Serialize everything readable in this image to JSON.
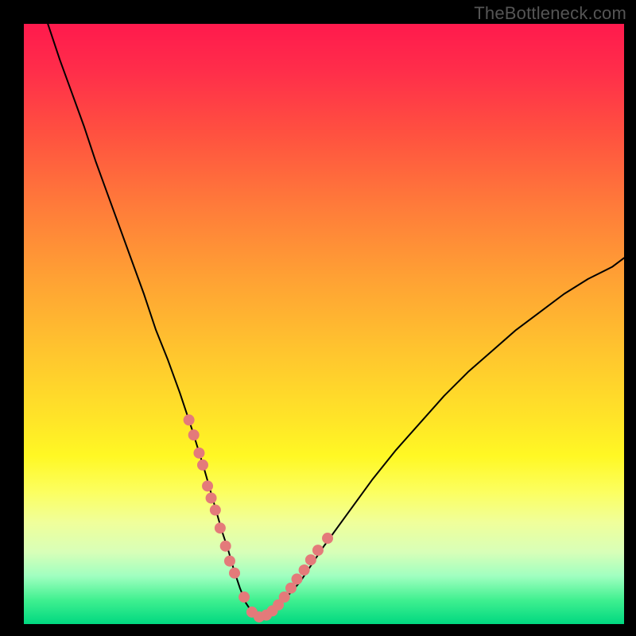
{
  "watermark": "TheBottleneck.com",
  "colors": {
    "frame": "#000000",
    "curve_stroke": "#000000",
    "dot_fill": "#e47a7a",
    "gradient_top": "#ff1a4d",
    "gradient_bottom": "#00d880"
  },
  "chart_data": {
    "type": "line",
    "title": "",
    "xlabel": "",
    "ylabel": "",
    "xlim": [
      0,
      100
    ],
    "ylim": [
      0,
      100
    ],
    "series": [
      {
        "name": "curve",
        "x": [
          4,
          6,
          8,
          10,
          12,
          14,
          16,
          18,
          20,
          22,
          24,
          26,
          28,
          30,
          31,
          32,
          33,
          34,
          35,
          36,
          37,
          38,
          39,
          40,
          42,
          46,
          50,
          54,
          58,
          62,
          66,
          70,
          74,
          78,
          82,
          86,
          90,
          94,
          98,
          100
        ],
        "y": [
          100,
          94,
          88.5,
          83,
          77,
          71.5,
          66,
          60.5,
          55,
          49,
          44,
          38.5,
          32.5,
          26,
          22.5,
          19,
          15.5,
          12.5,
          9,
          6,
          3.5,
          2,
          1.2,
          1.2,
          2.5,
          7,
          13,
          18.5,
          24,
          29,
          33.5,
          38,
          42,
          45.5,
          49,
          52,
          55,
          57.5,
          59.5,
          61
        ]
      }
    ],
    "dots": {
      "name": "highlight-points",
      "series": "curve",
      "x": [
        27.5,
        28.3,
        29.2,
        29.8,
        30.6,
        31.2,
        31.9,
        32.7,
        33.6,
        34.3,
        35.1,
        36.7,
        38.0,
        39.2,
        40.4,
        41.4,
        42.4,
        43.4,
        44.5,
        45.5,
        46.7,
        47.8,
        49.0,
        50.6
      ],
      "y": [
        34,
        31.5,
        28.5,
        26.5,
        23,
        21,
        19,
        16,
        13,
        10.5,
        8.5,
        4.5,
        2.0,
        1.2,
        1.5,
        2.2,
        3.2,
        4.5,
        6.0,
        7.5,
        9.0,
        10.7,
        12.3,
        14.3
      ]
    },
    "legend": null,
    "grid": false
  }
}
